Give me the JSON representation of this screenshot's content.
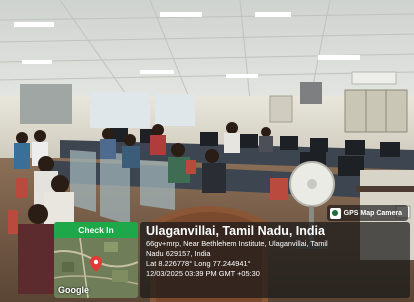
{
  "gps_badge": {
    "label": "GPS Map Camera",
    "icon": "camera-icon"
  },
  "map_card": {
    "button_label": "Check In",
    "logo": "Google",
    "pin_icon": "map-pin-icon"
  },
  "location": {
    "title": "Ulaganvillai, Tamil Nadu, India",
    "address_line1": "66gv+mrp, Near Bethlehem Institute, Ulaganvillai, Tamil",
    "address_line2": "Nadu 629157, India",
    "coordinates": "Lat 8.226778° Long 77.244941°",
    "timestamp": "12/03/2025 03:39 PM GMT +05:30"
  },
  "colors": {
    "checkin_green": "#1ea84a",
    "panel_bg": "#191919"
  }
}
